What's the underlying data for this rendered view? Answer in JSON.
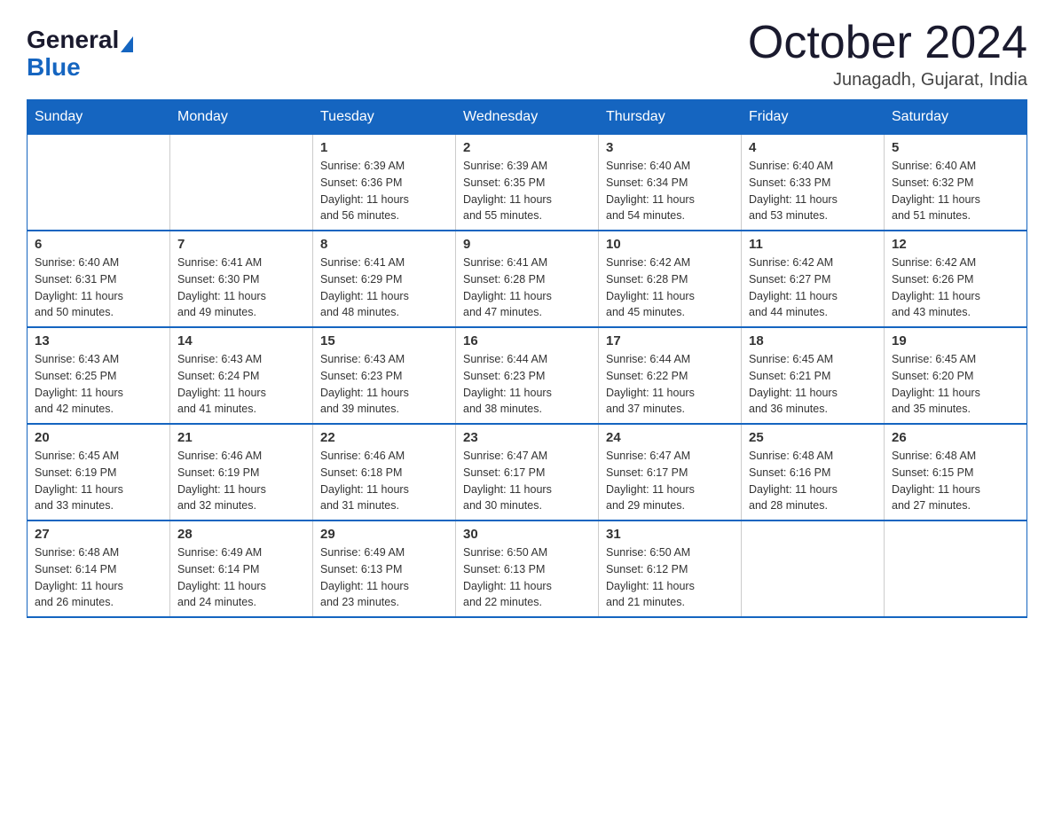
{
  "logo": {
    "general": "General",
    "blue": "Blue"
  },
  "title": "October 2024",
  "location": "Junagadh, Gujarat, India",
  "days_of_week": [
    "Sunday",
    "Monday",
    "Tuesday",
    "Wednesday",
    "Thursday",
    "Friday",
    "Saturday"
  ],
  "weeks": [
    [
      {
        "day": "",
        "info": ""
      },
      {
        "day": "",
        "info": ""
      },
      {
        "day": "1",
        "info": "Sunrise: 6:39 AM\nSunset: 6:36 PM\nDaylight: 11 hours\nand 56 minutes."
      },
      {
        "day": "2",
        "info": "Sunrise: 6:39 AM\nSunset: 6:35 PM\nDaylight: 11 hours\nand 55 minutes."
      },
      {
        "day": "3",
        "info": "Sunrise: 6:40 AM\nSunset: 6:34 PM\nDaylight: 11 hours\nand 54 minutes."
      },
      {
        "day": "4",
        "info": "Sunrise: 6:40 AM\nSunset: 6:33 PM\nDaylight: 11 hours\nand 53 minutes."
      },
      {
        "day": "5",
        "info": "Sunrise: 6:40 AM\nSunset: 6:32 PM\nDaylight: 11 hours\nand 51 minutes."
      }
    ],
    [
      {
        "day": "6",
        "info": "Sunrise: 6:40 AM\nSunset: 6:31 PM\nDaylight: 11 hours\nand 50 minutes."
      },
      {
        "day": "7",
        "info": "Sunrise: 6:41 AM\nSunset: 6:30 PM\nDaylight: 11 hours\nand 49 minutes."
      },
      {
        "day": "8",
        "info": "Sunrise: 6:41 AM\nSunset: 6:29 PM\nDaylight: 11 hours\nand 48 minutes."
      },
      {
        "day": "9",
        "info": "Sunrise: 6:41 AM\nSunset: 6:28 PM\nDaylight: 11 hours\nand 47 minutes."
      },
      {
        "day": "10",
        "info": "Sunrise: 6:42 AM\nSunset: 6:28 PM\nDaylight: 11 hours\nand 45 minutes."
      },
      {
        "day": "11",
        "info": "Sunrise: 6:42 AM\nSunset: 6:27 PM\nDaylight: 11 hours\nand 44 minutes."
      },
      {
        "day": "12",
        "info": "Sunrise: 6:42 AM\nSunset: 6:26 PM\nDaylight: 11 hours\nand 43 minutes."
      }
    ],
    [
      {
        "day": "13",
        "info": "Sunrise: 6:43 AM\nSunset: 6:25 PM\nDaylight: 11 hours\nand 42 minutes."
      },
      {
        "day": "14",
        "info": "Sunrise: 6:43 AM\nSunset: 6:24 PM\nDaylight: 11 hours\nand 41 minutes."
      },
      {
        "day": "15",
        "info": "Sunrise: 6:43 AM\nSunset: 6:23 PM\nDaylight: 11 hours\nand 39 minutes."
      },
      {
        "day": "16",
        "info": "Sunrise: 6:44 AM\nSunset: 6:23 PM\nDaylight: 11 hours\nand 38 minutes."
      },
      {
        "day": "17",
        "info": "Sunrise: 6:44 AM\nSunset: 6:22 PM\nDaylight: 11 hours\nand 37 minutes."
      },
      {
        "day": "18",
        "info": "Sunrise: 6:45 AM\nSunset: 6:21 PM\nDaylight: 11 hours\nand 36 minutes."
      },
      {
        "day": "19",
        "info": "Sunrise: 6:45 AM\nSunset: 6:20 PM\nDaylight: 11 hours\nand 35 minutes."
      }
    ],
    [
      {
        "day": "20",
        "info": "Sunrise: 6:45 AM\nSunset: 6:19 PM\nDaylight: 11 hours\nand 33 minutes."
      },
      {
        "day": "21",
        "info": "Sunrise: 6:46 AM\nSunset: 6:19 PM\nDaylight: 11 hours\nand 32 minutes."
      },
      {
        "day": "22",
        "info": "Sunrise: 6:46 AM\nSunset: 6:18 PM\nDaylight: 11 hours\nand 31 minutes."
      },
      {
        "day": "23",
        "info": "Sunrise: 6:47 AM\nSunset: 6:17 PM\nDaylight: 11 hours\nand 30 minutes."
      },
      {
        "day": "24",
        "info": "Sunrise: 6:47 AM\nSunset: 6:17 PM\nDaylight: 11 hours\nand 29 minutes."
      },
      {
        "day": "25",
        "info": "Sunrise: 6:48 AM\nSunset: 6:16 PM\nDaylight: 11 hours\nand 28 minutes."
      },
      {
        "day": "26",
        "info": "Sunrise: 6:48 AM\nSunset: 6:15 PM\nDaylight: 11 hours\nand 27 minutes."
      }
    ],
    [
      {
        "day": "27",
        "info": "Sunrise: 6:48 AM\nSunset: 6:14 PM\nDaylight: 11 hours\nand 26 minutes."
      },
      {
        "day": "28",
        "info": "Sunrise: 6:49 AM\nSunset: 6:14 PM\nDaylight: 11 hours\nand 24 minutes."
      },
      {
        "day": "29",
        "info": "Sunrise: 6:49 AM\nSunset: 6:13 PM\nDaylight: 11 hours\nand 23 minutes."
      },
      {
        "day": "30",
        "info": "Sunrise: 6:50 AM\nSunset: 6:13 PM\nDaylight: 11 hours\nand 22 minutes."
      },
      {
        "day": "31",
        "info": "Sunrise: 6:50 AM\nSunset: 6:12 PM\nDaylight: 11 hours\nand 21 minutes."
      },
      {
        "day": "",
        "info": ""
      },
      {
        "day": "",
        "info": ""
      }
    ]
  ]
}
